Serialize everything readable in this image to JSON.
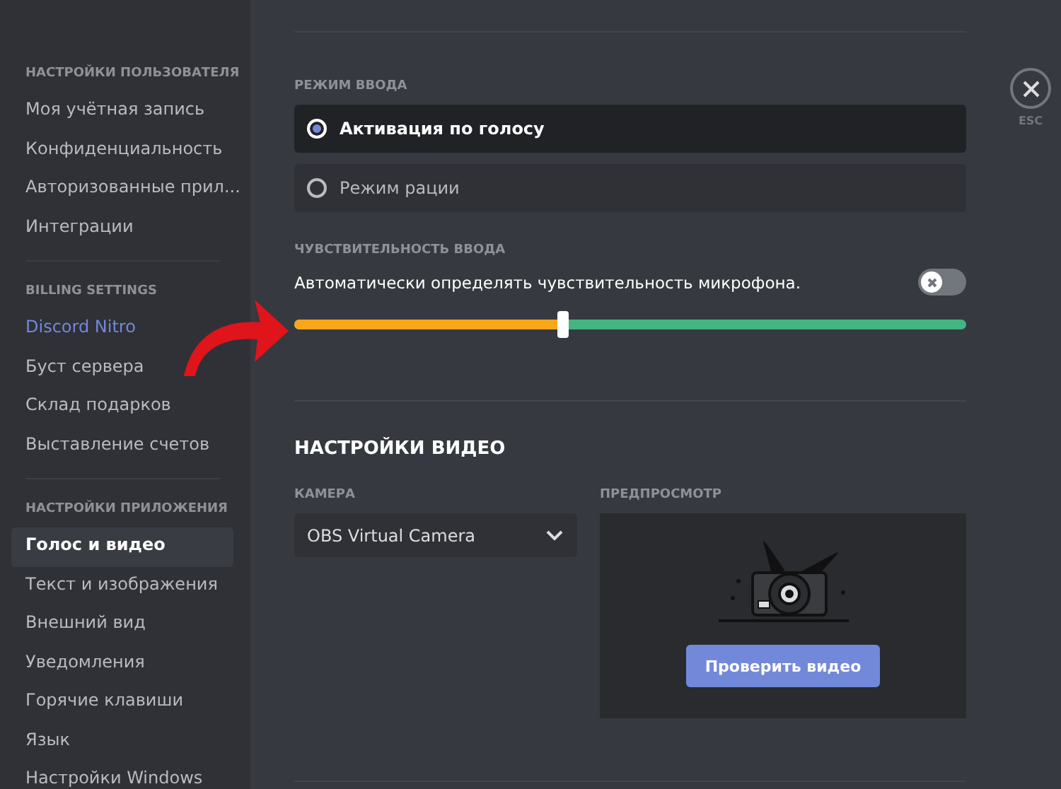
{
  "sidebar": {
    "sections": [
      {
        "heading": "НАСТРОЙКИ ПОЛЬЗОВАТЕЛЯ",
        "items": [
          {
            "label": "Моя учётная запись",
            "kind": "normal",
            "selected": false
          },
          {
            "label": "Конфиденциальность",
            "kind": "normal",
            "selected": false
          },
          {
            "label": "Авторизованные прил...",
            "kind": "normal",
            "selected": false
          },
          {
            "label": "Интеграции",
            "kind": "normal",
            "selected": false
          }
        ]
      },
      {
        "heading": "BILLING SETTINGS",
        "items": [
          {
            "label": "Discord Nitro",
            "kind": "nitro",
            "selected": false
          },
          {
            "label": "Буст сервера",
            "kind": "normal",
            "selected": false
          },
          {
            "label": "Склад подарков",
            "kind": "normal",
            "selected": false
          },
          {
            "label": "Выставление счетов",
            "kind": "normal",
            "selected": false
          }
        ]
      },
      {
        "heading": "НАСТРОЙКИ ПРИЛОЖЕНИЯ",
        "items": [
          {
            "label": "Голос и видео",
            "kind": "normal",
            "selected": true
          },
          {
            "label": "Текст и изображения",
            "kind": "normal",
            "selected": false
          },
          {
            "label": "Внешний вид",
            "kind": "normal",
            "selected": false
          },
          {
            "label": "Уведомления",
            "kind": "normal",
            "selected": false
          },
          {
            "label": "Горячие клавиши",
            "kind": "normal",
            "selected": false
          },
          {
            "label": "Язык",
            "kind": "normal",
            "selected": false
          },
          {
            "label": "Настройки Windows",
            "kind": "normal",
            "selected": false
          }
        ]
      }
    ]
  },
  "input_mode": {
    "heading": "РЕЖИМ ВВОДА",
    "options": [
      {
        "label": "Активация по голосу",
        "selected": true
      },
      {
        "label": "Режим рации",
        "selected": false
      }
    ]
  },
  "sensitivity": {
    "heading": "ЧУВСТВИТЕЛЬНОСТЬ ВВОДА",
    "auto_label": "Автоматически определять чувствительность микрофона.",
    "auto_on": false,
    "level": 0.4
  },
  "video": {
    "title": "НАСТРОЙКИ ВИДЕО",
    "camera_label": "КАМЕРА",
    "camera_value": "OBS Virtual Camera",
    "preview_label": "ПРЕДПРОСМОТР",
    "test_button": "Проверить видео"
  },
  "close": {
    "label": "ESC"
  }
}
